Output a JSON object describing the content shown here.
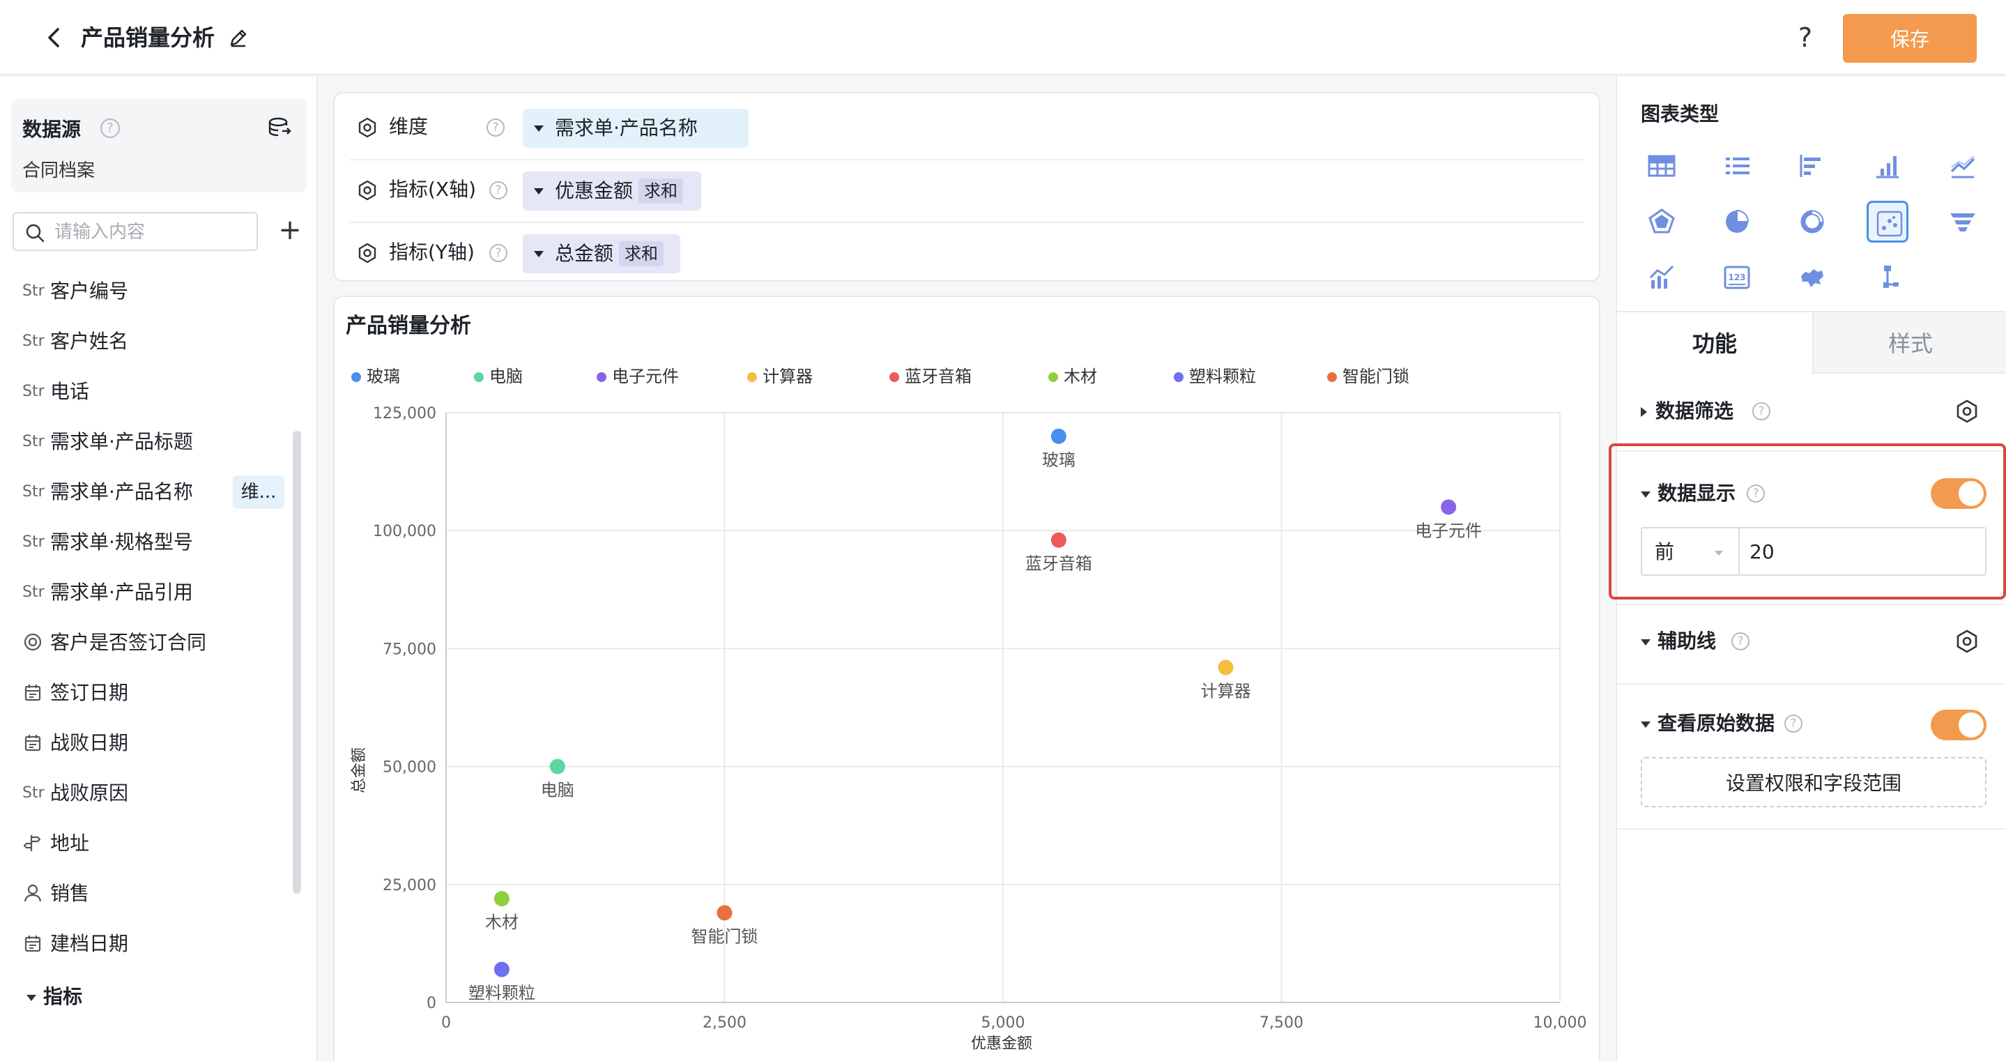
{
  "header": {
    "title": "产品销量分析",
    "help": "?",
    "save_label": "保存"
  },
  "left": {
    "datasource_title": "数据源",
    "datasource_name": "合同档案",
    "search_placeholder": "请输入内容",
    "add": "+",
    "fields": [
      {
        "type": "Str",
        "label": "客户编号",
        "icon": "text-type-icon"
      },
      {
        "type": "Str",
        "label": "客户姓名",
        "icon": "text-type-icon"
      },
      {
        "type": "Str",
        "label": "电话",
        "icon": "text-type-icon"
      },
      {
        "type": "Str",
        "label": "需求单·产品标题",
        "icon": "text-type-icon"
      },
      {
        "type": "Str",
        "label": "需求单·产品名称",
        "icon": "text-type-icon",
        "badge": "维..."
      },
      {
        "type": "Str",
        "label": "需求单·规格型号",
        "icon": "text-type-icon"
      },
      {
        "type": "Str",
        "label": "需求单·产品引用",
        "icon": "text-type-icon"
      },
      {
        "type": "",
        "label": "客户是否签订合同",
        "icon": "radio-type-icon"
      },
      {
        "type": "",
        "label": "签订日期",
        "icon": "calendar-icon"
      },
      {
        "type": "",
        "label": "战败日期",
        "icon": "calendar-icon"
      },
      {
        "type": "Str",
        "label": "战败原因",
        "icon": "text-type-icon"
      },
      {
        "type": "",
        "label": "地址",
        "icon": "address-icon"
      },
      {
        "type": "",
        "label": "销售",
        "icon": "user-icon"
      },
      {
        "type": "",
        "label": "建档日期",
        "icon": "calendar-icon"
      }
    ],
    "metric_header": "指标"
  },
  "config": {
    "rows": [
      {
        "label": "维度",
        "pill": "需求单·产品名称",
        "agg": "",
        "kind": "dimension"
      },
      {
        "label": "指标(X轴)",
        "pill": "优惠金额",
        "agg": "求和",
        "kind": "metric"
      },
      {
        "label": "指标(Y轴)",
        "pill": "总金额",
        "agg": "求和",
        "kind": "metric"
      }
    ],
    "help": "?"
  },
  "chart_data": {
    "type": "scatter",
    "title": "产品销量分析",
    "xlabel": "优惠金额",
    "ylabel": "总金额",
    "xlim": [
      0,
      10000
    ],
    "ylim": [
      0,
      125000
    ],
    "xticks": [
      0,
      2500,
      5000,
      7500,
      10000
    ],
    "yticks": [
      0,
      25000,
      50000,
      75000,
      100000,
      125000
    ],
    "xtick_labels": [
      "0",
      "2,500",
      "5,000",
      "7,500",
      "10,000"
    ],
    "ytick_labels": [
      "0",
      "25,000",
      "50,000",
      "75,000",
      "100,000",
      "125,000"
    ],
    "grid": true,
    "legend_position": "top-left",
    "points": [
      {
        "name": "玻璃",
        "x": 5500,
        "y": 120000,
        "color": "#4a8ff0"
      },
      {
        "name": "电脑",
        "x": 1000,
        "y": 50000,
        "color": "#5cd6a0"
      },
      {
        "name": "电子元件",
        "x": 9000,
        "y": 105000,
        "color": "#8a63e8"
      },
      {
        "name": "计算器",
        "x": 7000,
        "y": 71000,
        "color": "#f5bd3c"
      },
      {
        "name": "蓝牙音箱",
        "x": 5500,
        "y": 98000,
        "color": "#ec5b5b"
      },
      {
        "name": "木材",
        "x": 500,
        "y": 22000,
        "color": "#8fcf3c"
      },
      {
        "name": "塑料颗粒",
        "x": 500,
        "y": 7000,
        "color": "#6f6ff0"
      },
      {
        "name": "智能门锁",
        "x": 2500,
        "y": 19000,
        "color": "#e9703e"
      }
    ]
  },
  "right": {
    "chart_type_title": "图表类型",
    "tabs": [
      "功能",
      "样式"
    ],
    "sections": {
      "filter": "数据筛选",
      "display": "数据显示",
      "guide": "辅助线",
      "raw": "查看原始数据"
    },
    "top_select": "前",
    "top_value": "20",
    "perm_button": "设置权限和字段范围",
    "help": "?"
  },
  "colors": {
    "accent": "#f39a4e",
    "highlight": "#d9483b",
    "selected": "#4a90e2"
  }
}
